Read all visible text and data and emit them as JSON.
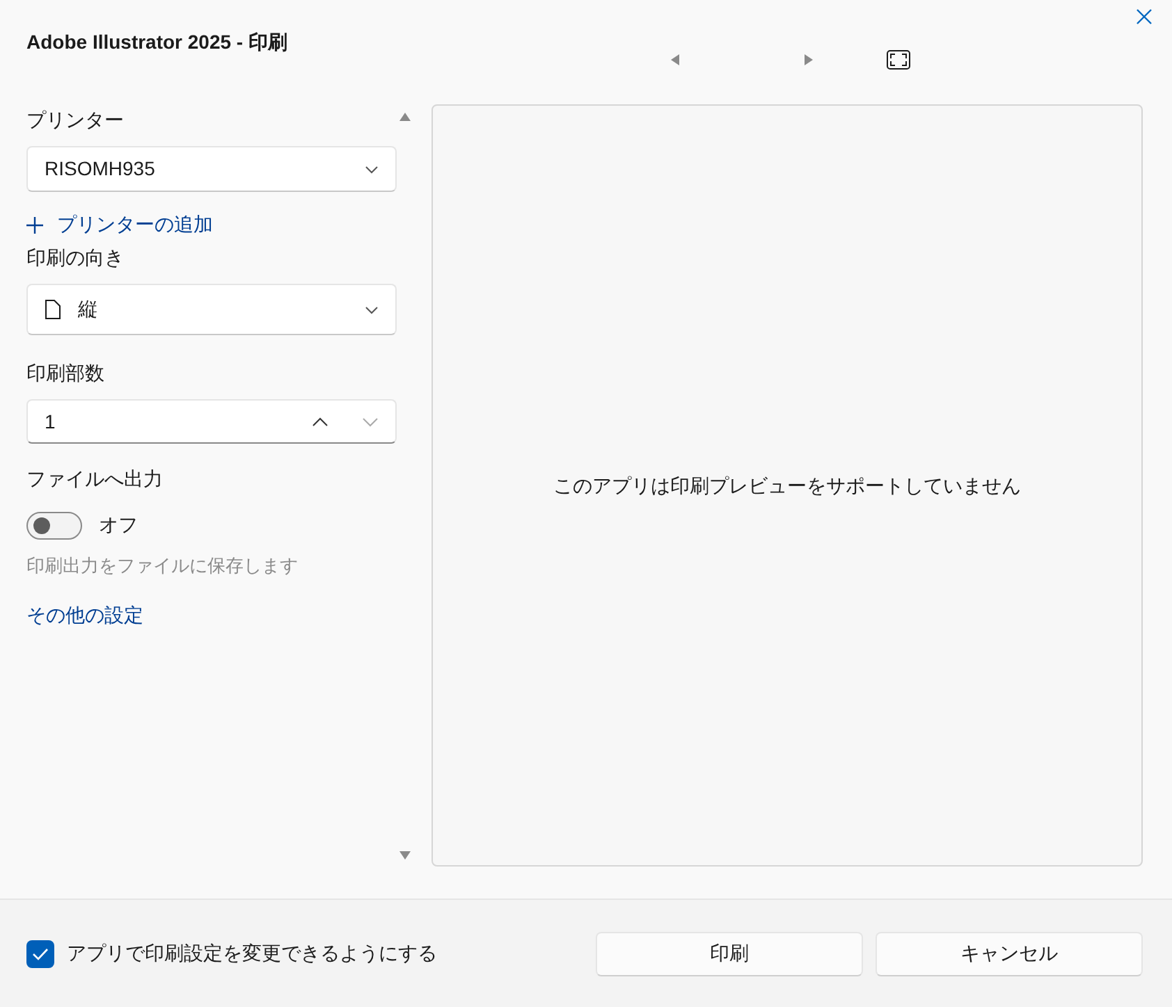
{
  "window": {
    "title": "Adobe Illustrator 2025 - 印刷"
  },
  "settings": {
    "printer": {
      "label": "プリンター",
      "value": "RISOMH935"
    },
    "add_printer": "プリンターの追加",
    "orientation": {
      "label": "印刷の向き",
      "value": "縦"
    },
    "copies": {
      "label": "印刷部数",
      "value": "1"
    },
    "print_to_file": {
      "label": "ファイルへ出力",
      "on": false,
      "state_label": "オフ",
      "description": "印刷出力をファイルに保存します"
    },
    "more_settings": "その他の設定"
  },
  "preview": {
    "message": "このアプリは印刷プレビューをサポートしていません"
  },
  "footer": {
    "allow_app_settings": {
      "label": "アプリで印刷設定を変更できるようにする",
      "checked": true
    },
    "buttons": [
      "印刷",
      "キャンセル"
    ]
  }
}
